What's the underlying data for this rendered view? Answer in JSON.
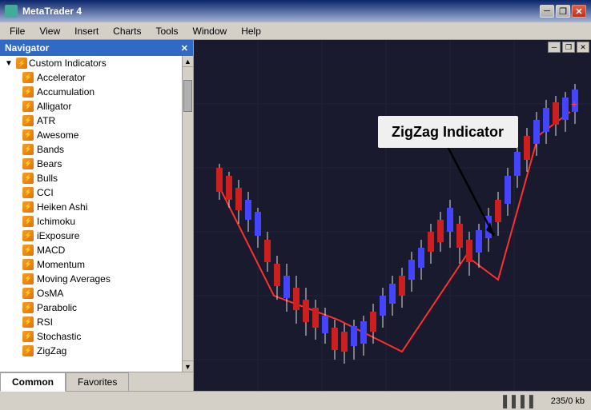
{
  "titleBar": {
    "title": "MetaTrader 4",
    "minimizeLabel": "─",
    "restoreLabel": "❐",
    "closeLabel": "✕"
  },
  "menuBar": {
    "items": [
      "File",
      "View",
      "Insert",
      "Charts",
      "Tools",
      "Window",
      "Help"
    ]
  },
  "navigator": {
    "title": "Navigator",
    "closeLabel": "✕",
    "section": {
      "label": "Custom Indicators",
      "items": [
        "Accelerator",
        "Accumulation",
        "Alligator",
        "ATR",
        "Awesome",
        "Bands",
        "Bears",
        "Bulls",
        "CCI",
        "Heiken Ashi",
        "Ichimoku",
        "iExposure",
        "MACD",
        "Momentum",
        "Moving Averages",
        "OsMA",
        "Parabolic",
        "RSI",
        "Stochastic",
        "ZigZag"
      ]
    }
  },
  "tabs": {
    "common": "Common",
    "favorites": "Favorites"
  },
  "chart": {
    "indicatorLabel": "ZigZag Indicator"
  },
  "statusBar": {
    "icon": "▌▌▌▌",
    "memory": "235/0 kb"
  },
  "innerWindow": {
    "minimizeLabel": "─",
    "restoreLabel": "❐",
    "closeLabel": "✕"
  }
}
